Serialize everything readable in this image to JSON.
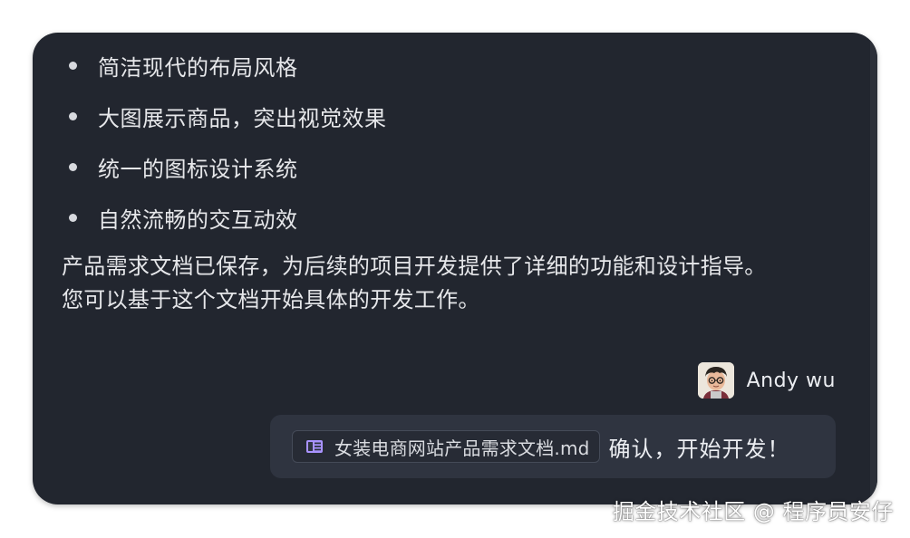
{
  "features": [
    {
      "label": "简洁现代的布局风格"
    },
    {
      "label": "大图展示商品，突出视觉效果"
    },
    {
      "label": "统一的图标设计系统"
    },
    {
      "label": "自然流畅的交互动效"
    }
  ],
  "summary": {
    "line1": "产品需求文档已保存，为后续的项目开发提供了详细的功能和设计指导。",
    "line2": "您可以基于这个文档开始具体的开发工作。"
  },
  "user": {
    "name": "Andy wu",
    "avatar_icon": "avatar-cartoon-icon"
  },
  "message": {
    "file_icon": "document-icon",
    "file_icon_color": "#a993ff",
    "file_name": "女装电商网站产品需求文档.md",
    "text": "确认，开始开发！"
  },
  "watermark": "掘金技术社区 @ 程序员安仔",
  "colors": {
    "panel_bg": "#22262f",
    "message_bg": "#2f3440",
    "text": "#e6e7ea"
  }
}
